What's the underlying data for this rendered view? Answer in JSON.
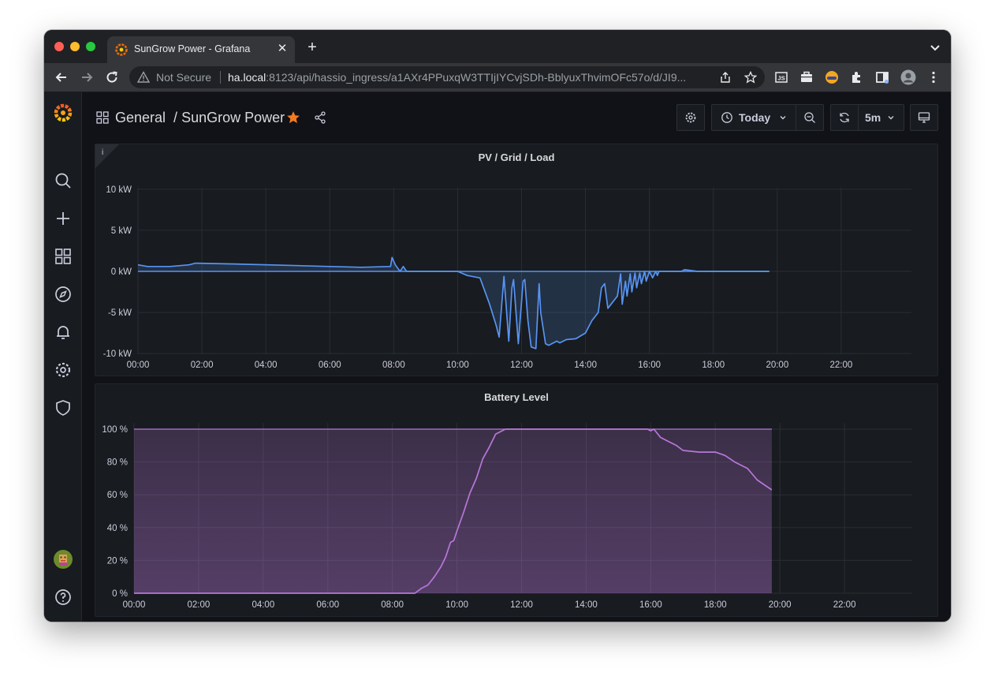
{
  "browser": {
    "tab_title": "SunGrow Power - Grafana",
    "security_label": "Not Secure",
    "url_host": "ha.local",
    "url_path": ":8123/api/hassio_ingress/a1AXr4PPuxqW3TTIjIYCvjSDh-BblyuxThvimOFc57o/d/JI9..."
  },
  "dashboard": {
    "folder": "General",
    "title": "SunGrow Power",
    "time_range": "Today",
    "refresh": "5m"
  },
  "colors": {
    "pv_series": "#5794f2",
    "battery_series": "#b877d9",
    "grafana_orange": "#f46800"
  },
  "chart_data": [
    {
      "type": "area",
      "title": "PV / Grid / Load",
      "ylim": [
        -12,
        12
      ],
      "yticks": [
        "10 kW",
        "5 kW",
        "0 kW",
        "-5 kW",
        "-10 kW"
      ],
      "ytick_values": [
        10,
        5,
        0,
        -5,
        -10
      ],
      "xlim": [
        0,
        24
      ],
      "xticks": [
        "00:00",
        "02:00",
        "04:00",
        "06:00",
        "08:00",
        "10:00",
        "12:00",
        "14:00",
        "16:00",
        "18:00",
        "20:00",
        "22:00"
      ],
      "grid": true,
      "series": [
        {
          "color": "#5794f2",
          "x": [
            0,
            0.3,
            1,
            1.6,
            1.8,
            3,
            5,
            6,
            7,
            7.9,
            7.95,
            8.05,
            8.2,
            8.3,
            8.4,
            8.5,
            9,
            10,
            10.3,
            10.7,
            11.0,
            11.2,
            11.3,
            11.45,
            11.6,
            11.7,
            11.75,
            11.9,
            12.05,
            12.1,
            12.2,
            12.3,
            12.45,
            12.55,
            12.6,
            12.75,
            12.85,
            13.1,
            13.2,
            13.4,
            13.7,
            14.0,
            14.2,
            14.4,
            14.5,
            14.6,
            14.7,
            14.8,
            15.0,
            15.1,
            15.15,
            15.25,
            15.3,
            15.4,
            15.45,
            15.55,
            15.6,
            15.7,
            15.75,
            15.85,
            15.9,
            16.0,
            16.1,
            16.2,
            16.25,
            16.3,
            16.4,
            17,
            17.1,
            17.5,
            18,
            19,
            19.75
          ],
          "y": [
            0.8,
            0.6,
            0.6,
            0.8,
            1.0,
            0.9,
            0.7,
            0.6,
            0.5,
            0.6,
            1.7,
            0.8,
            0.0,
            0.6,
            0.0,
            0.0,
            0.0,
            0.0,
            -0.5,
            -0.8,
            -4.0,
            -6.5,
            -8.0,
            -0.6,
            -8.5,
            -2.0,
            -1.0,
            -8.8,
            -1.2,
            -1.0,
            -6.0,
            -9.2,
            -9.4,
            -1.5,
            -5.0,
            -8.8,
            -9.0,
            -8.5,
            -8.7,
            -8.3,
            -8.2,
            -7.5,
            -6.0,
            -5.0,
            -2.0,
            -1.5,
            -4.5,
            -4.0,
            -3.0,
            -0.3,
            -4.0,
            -1.2,
            -3.0,
            -0.3,
            -2.5,
            -0.2,
            -2.0,
            -0.2,
            -1.5,
            0.0,
            -1.2,
            0.0,
            -0.8,
            0.0,
            -0.5,
            0.0,
            0.0,
            0.0,
            0.2,
            0.0,
            0.0,
            0.0,
            0.0
          ]
        }
      ]
    },
    {
      "type": "area",
      "title": "Battery Level",
      "ylim": [
        0,
        100
      ],
      "yticks": [
        "100 %",
        "80 %",
        "60 %",
        "40 %",
        "20 %",
        "0 %"
      ],
      "ytick_values": [
        100,
        80,
        60,
        40,
        20,
        0
      ],
      "xlim": [
        0,
        24
      ],
      "xticks": [
        "00:00",
        "02:00",
        "04:00",
        "06:00",
        "08:00",
        "10:00",
        "12:00",
        "14:00",
        "16:00",
        "18:00",
        "20:00",
        "22:00"
      ],
      "grid": true,
      "series": [
        {
          "color": "#b877d9",
          "x": [
            0,
            8.7,
            8.9,
            9.1,
            9.3,
            9.5,
            9.65,
            9.8,
            9.9,
            10.0,
            10.2,
            10.4,
            10.6,
            10.8,
            11.0,
            11.2,
            11.4,
            11.5,
            12.0,
            13.0,
            14.0,
            15.0,
            15.9,
            16.0,
            16.1,
            16.3,
            16.5,
            16.8,
            17.0,
            17.5,
            18.0,
            18.3,
            18.6,
            19.0,
            19.3,
            19.75
          ],
          "y": [
            0,
            0,
            3,
            5,
            10,
            16,
            22,
            31,
            32,
            38,
            49,
            61,
            70,
            82,
            89,
            97,
            99,
            100,
            100,
            100,
            100,
            100,
            100,
            99,
            100,
            95,
            93,
            90,
            87,
            86,
            86,
            84,
            80,
            76,
            69,
            63
          ]
        }
      ]
    }
  ]
}
